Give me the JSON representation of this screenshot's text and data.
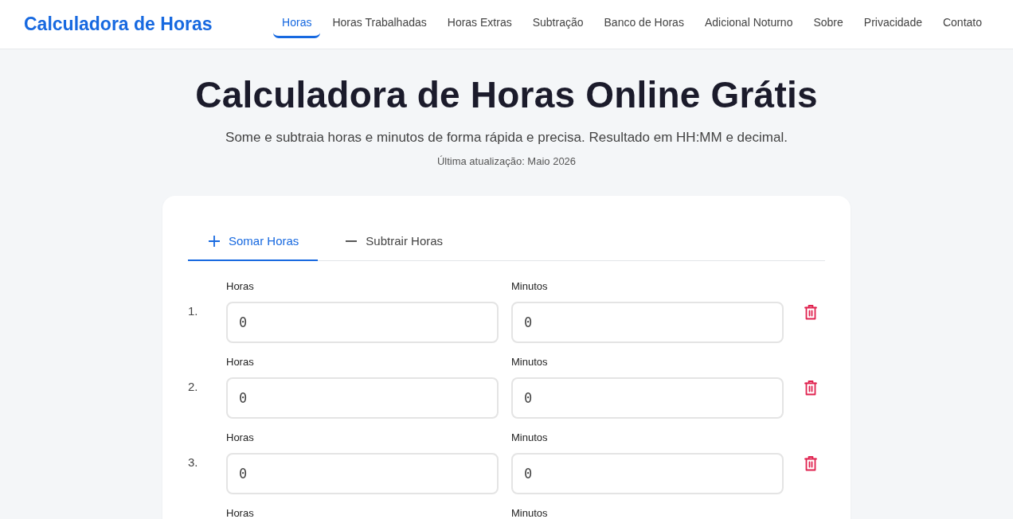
{
  "header": {
    "logo": "Calculadora de Horas",
    "nav": [
      {
        "label": "Horas",
        "selected": true
      },
      {
        "label": "Horas Trabalhadas",
        "selected": false
      },
      {
        "label": "Horas Extras",
        "selected": false
      },
      {
        "label": "Subtração",
        "selected": false
      },
      {
        "label": "Banco de Horas",
        "selected": false
      },
      {
        "label": "Adicional Noturno",
        "selected": false
      },
      {
        "label": "Sobre",
        "selected": false
      },
      {
        "label": "Privacidade",
        "selected": false
      },
      {
        "label": "Contato",
        "selected": false
      }
    ]
  },
  "hero": {
    "title": "Calculadora de Horas Online Grátis",
    "subtitle": "Some e subtraia horas e minutos de forma rápida e precisa. Resultado em HH:MM e decimal.",
    "updated": "Última atualização: Maio 2026"
  },
  "calculator": {
    "tabs": [
      {
        "kind": "add",
        "label": "Somar Horas",
        "selected": true
      },
      {
        "kind": "subtract",
        "label": "Subtrair Horas",
        "selected": false
      }
    ],
    "rows": [
      {
        "number": "1.",
        "hours_label": "Horas",
        "hours_value": "0",
        "minutes_label": "Minutos",
        "minutes_value": "0"
      },
      {
        "number": "2.",
        "hours_label": "Horas",
        "hours_value": "0",
        "minutes_label": "Minutos",
        "minutes_value": "0"
      },
      {
        "number": "3.",
        "hours_label": "Horas",
        "hours_value": "0",
        "minutes_label": "Minutos",
        "minutes_value": "0"
      },
      {
        "hours_label": "Horas",
        "minutes_label": "Minutos"
      }
    ]
  }
}
